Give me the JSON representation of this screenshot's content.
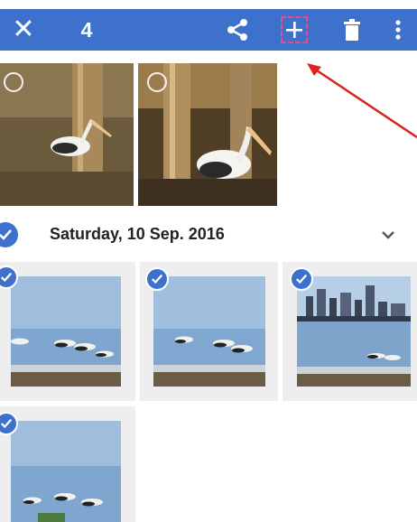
{
  "toolbar": {
    "selected_count": "4",
    "icons": [
      "close-icon",
      "share-icon",
      "add-icon",
      "delete-icon",
      "more-vert-icon"
    ],
    "color": "#3d71cc"
  },
  "date_section": {
    "label": "Saturday, 10 Sep. 2016",
    "selected": true
  },
  "annotation": {
    "highlight_color": "#e84a8a",
    "arrow_color": "#e0201c"
  },
  "photos_top": [
    {
      "subject": "pelican on pier",
      "selected": false
    },
    {
      "subject": "pelican on pier",
      "selected": false
    }
  ],
  "photos_section": [
    {
      "subject": "pelicans on water",
      "selected": true
    },
    {
      "subject": "pelicans on water",
      "selected": true
    },
    {
      "subject": "city skyline with pelicans",
      "selected": true
    },
    {
      "subject": "pelicans on water",
      "selected": true
    }
  ]
}
